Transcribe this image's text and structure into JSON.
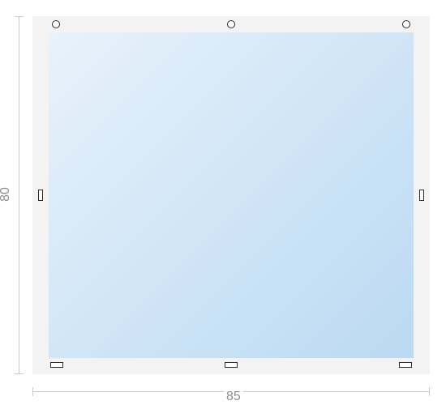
{
  "dimensions": {
    "width_label": "85",
    "height_label": "80"
  }
}
